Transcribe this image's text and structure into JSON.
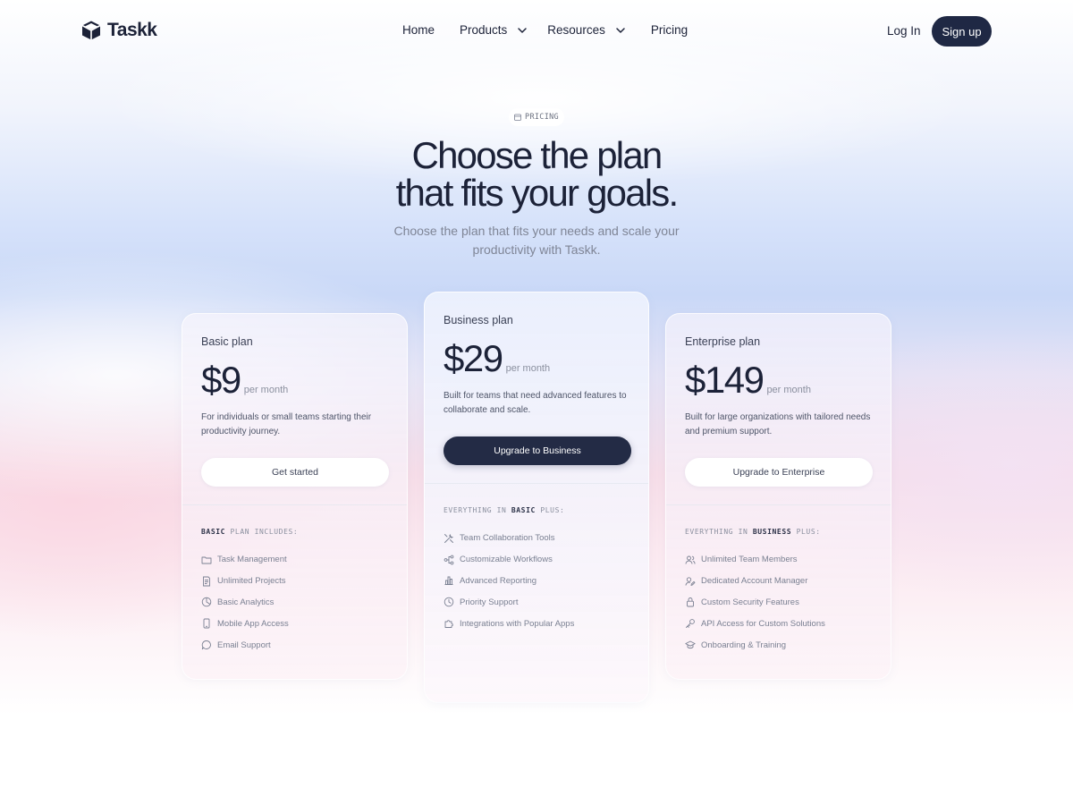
{
  "nav": {
    "logo": "Taskk",
    "links": [
      {
        "label": "Home"
      },
      {
        "label": "Products"
      },
      {
        "label": "Resources"
      },
      {
        "label": "Pricing"
      }
    ],
    "login": "Log In",
    "signup": "Sign up"
  },
  "hero": {
    "badge": "PRICING",
    "title_line1": "Choose the plan",
    "title_line2": "that fits your goals.",
    "subtitle": "Choose the plan that fits your needs and scale your productivity with Taskk."
  },
  "plans": [
    {
      "name": "Basic plan",
      "price": "$9",
      "period": "per month",
      "description": "For individuals or small teams starting their productivity journey.",
      "cta": "Get started",
      "includes_prefix": "",
      "includes_bold": "BASIC",
      "includes_suffix": " PLAN INCLUDES:",
      "features": [
        {
          "label": "Task Management",
          "icon": "folder-icon"
        },
        {
          "label": "Unlimited Projects",
          "icon": "document-icon"
        },
        {
          "label": "Basic Analytics",
          "icon": "pie-chart-icon"
        },
        {
          "label": "Mobile App Access",
          "icon": "phone-icon"
        },
        {
          "label": "Email Support",
          "icon": "chat-icon"
        }
      ]
    },
    {
      "name": "Business plan",
      "price": "$29",
      "period": "per month",
      "description": "Built for teams that need advanced features to collaborate and scale.",
      "cta": "Upgrade to Business",
      "includes_prefix": "EVERYTHING IN ",
      "includes_bold": "BASIC",
      "includes_suffix": " PLUS:",
      "features": [
        {
          "label": "Team Collaboration Tools",
          "icon": "tools-icon"
        },
        {
          "label": "Customizable Workflows",
          "icon": "workflow-icon"
        },
        {
          "label": "Advanced Reporting",
          "icon": "bar-chart-icon"
        },
        {
          "label": "Priority Support",
          "icon": "clock-icon"
        },
        {
          "label": "Integrations with Popular Apps",
          "icon": "puzzle-icon"
        }
      ]
    },
    {
      "name": "Enterprise plan",
      "price": "$149",
      "period": "per month",
      "description": "Built for large organizations with tailored needs and premium support.",
      "cta": "Upgrade to Enterprise",
      "includes_prefix": "EVERYTHING IN ",
      "includes_bold": "BUSINESS",
      "includes_suffix": " PLUS:",
      "features": [
        {
          "label": "Unlimited Team Members",
          "icon": "users-icon"
        },
        {
          "label": "Dedicated Account Manager",
          "icon": "user-edit-icon"
        },
        {
          "label": "Custom Security Features",
          "icon": "lock-icon"
        },
        {
          "label": "API Access for Custom Solutions",
          "icon": "key-icon"
        },
        {
          "label": "Onboarding & Training",
          "icon": "graduation-cap-icon"
        }
      ]
    }
  ],
  "colors": {
    "primary_dark": "#1f2844",
    "text_dark": "#1c2238",
    "text_muted": "#7f8596"
  }
}
